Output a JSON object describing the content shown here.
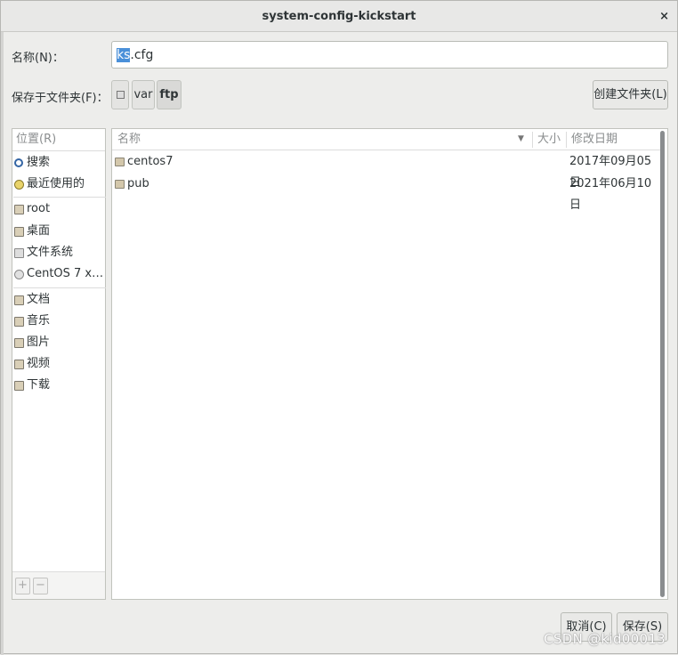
{
  "window": {
    "title": "system-config-kickstart",
    "close_glyph": "×"
  },
  "name_row": {
    "label": "名称(N)：",
    "selected": "ks",
    "rest": ".cfg"
  },
  "folder_row": {
    "label": "保存于文件夹(F)：",
    "crumbs": [
      "var",
      "ftp"
    ],
    "create_button": "创建文件夹(L)"
  },
  "places": {
    "header": "位置(R)",
    "items": [
      {
        "label": "搜索",
        "icon": "search-icon"
      },
      {
        "label": "最近使用的",
        "icon": "recent-icon"
      },
      {
        "label": "root",
        "icon": "home-folder-icon"
      },
      {
        "label": "桌面",
        "icon": "desktop-folder-icon"
      },
      {
        "label": "文件系统",
        "icon": "drive-icon"
      },
      {
        "label": "CentOS 7 x…",
        "icon": "disc-icon"
      },
      {
        "label": "文档",
        "icon": "documents-folder-icon"
      },
      {
        "label": "音乐",
        "icon": "music-folder-icon"
      },
      {
        "label": "图片",
        "icon": "pictures-folder-icon"
      },
      {
        "label": "视频",
        "icon": "videos-folder-icon"
      },
      {
        "label": "下载",
        "icon": "downloads-folder-icon"
      }
    ],
    "add": "+",
    "remove": "−"
  },
  "files": {
    "columns": {
      "name": "名称",
      "size": "大小",
      "date": "修改日期"
    },
    "rows": [
      {
        "name": "centos7",
        "date": "2017年09月05日"
      },
      {
        "name": "pub",
        "date": "2021年06月10日"
      }
    ]
  },
  "footer": {
    "cancel": "取消(C)",
    "save": "保存(S)"
  },
  "watermark": "CSDN @kid00013",
  "colors": {
    "selection": "#4a90d9"
  }
}
